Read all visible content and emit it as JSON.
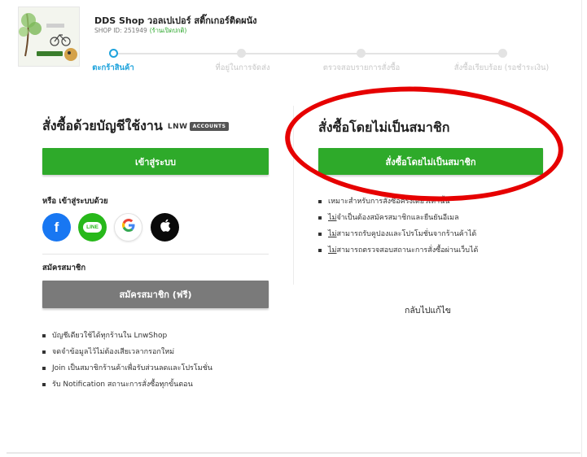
{
  "header": {
    "shop_name": "DDS Shop วอลเปเปอร์ สติ๊กเกอร์ติดผนัง",
    "shop_id_label": "SHOP ID: 251949",
    "shop_status": "(ร้านเปิดปกติ)"
  },
  "stepper": {
    "steps": [
      {
        "label": "ตะกร้าสินค้า",
        "active": true
      },
      {
        "label": "ที่อยู่ในการจัดส่ง",
        "active": false
      },
      {
        "label": "ตรวจสอบรายการสั่งซื้อ",
        "active": false
      },
      {
        "label": "สั่งซื้อเรียบร้อย (รอชำระเงิน)",
        "active": false
      }
    ]
  },
  "left": {
    "title": "สั่งซื้อด้วยบัญชีใช้งาน",
    "brand_text": "LNW",
    "brand_tag": "ACCOUNTS",
    "login_button": "เข้าสู่ระบบ",
    "or_login_with": "หรือ เข้าสู่ระบบด้วย",
    "social": {
      "facebook_glyph": "f",
      "line_glyph": "LINE",
      "google_glyph": "G",
      "apple_glyph": ""
    },
    "signup_label": "สมัครสมาชิก",
    "signup_button": "สมัครสมาชิก (ฟรี)",
    "benefits": [
      "บัญชีเดียวใช้ได้ทุกร้านใน LnwShop",
      "จดจำข้อมูลไว้ไม่ต้องเสียเวลากรอกใหม่",
      "Join เป็นสมาชิกร้านค้าเพื่อรับส่วนลดและโปรโมชั่น",
      "รับ Notification สถานะการสั่งซื้อทุกขั้นตอน"
    ]
  },
  "right": {
    "title": "สั่งซื้อโดยไม่เป็นสมาชิก",
    "guest_button": "สั่งซื้อโดยไม่เป็นสมาชิก",
    "notes": [
      {
        "prefix": "",
        "text": "เหมาะสำหรับการสั่งซื้อครั้งเดียวเท่านั้น"
      },
      {
        "prefix": "ไม่",
        "text": "จำเป็นต้องสมัครสมาชิกและยืนยันอีเมล"
      },
      {
        "prefix": "ไม่",
        "text": "สามารถรับคูปองและโปรโมชั่นจากร้านค้าได้"
      },
      {
        "prefix": "ไม่",
        "text": "สามารถตรวจสอบสถานะการสั่งซื้อผ่านเว็บได้"
      }
    ],
    "back_link": "กลับไปแก้ไข"
  },
  "colors": {
    "primary_green": "#2eaa2a",
    "accent_blue": "#1fa3dc",
    "annotation_red": "#e60000",
    "facebook_blue": "#1877f2",
    "line_green": "#27b81a"
  }
}
